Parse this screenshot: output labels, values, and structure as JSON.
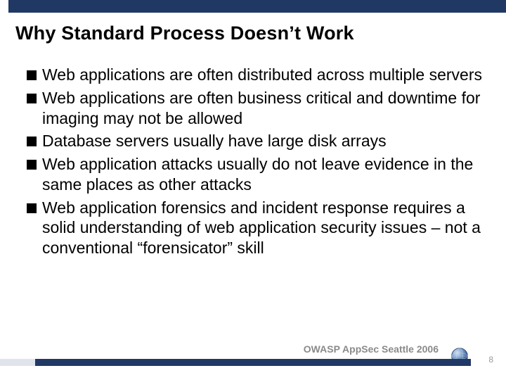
{
  "slide": {
    "title": "Why Standard Process Doesn’t Work",
    "bullets": [
      "Web applications are often distributed across multiple servers",
      "Web applications are often business critical and downtime for imaging may not be allowed",
      "Database servers usually have large disk arrays",
      "Web application attacks usually do not leave evidence in the same places as other attacks",
      "Web application forensics and incident response requires a solid understanding of web application security issues – not a conventional “forensicator” skill"
    ],
    "footer": "OWASP AppSec Seattle 2006",
    "page_number": "8"
  },
  "colors": {
    "accent": "#203864"
  }
}
